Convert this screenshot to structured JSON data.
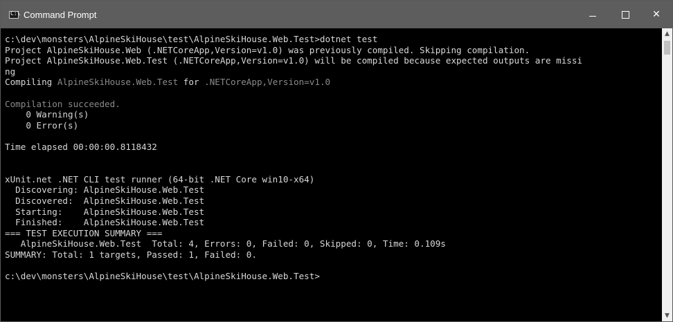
{
  "window": {
    "title": "Command Prompt",
    "controls": {
      "minimize": "—",
      "maximize": "",
      "close": "✕"
    },
    "app_icon": "command-prompt-icon",
    "icon_glyph": "C:\\"
  },
  "console": {
    "lines": [
      {
        "text": "c:\\dev\\monsters\\AlpineSkiHouse\\test\\AlpineSkiHouse.Web.Test>dotnet test"
      },
      {
        "text": "Project AlpineSkiHouse.Web (.NETCoreApp,Version=v1.0) was previously compiled. Skipping compilation."
      },
      {
        "text": "Project AlpineSkiHouse.Web.Test (.NETCoreApp,Version=v1.0) will be compiled because expected outputs are missi"
      },
      {
        "text": "ng"
      },
      {
        "parts": [
          {
            "text": "Compiling ",
            "style": "normal"
          },
          {
            "text": "AlpineSkiHouse.Web.Test",
            "style": "dim"
          },
          {
            "text": " for ",
            "style": "normal"
          },
          {
            "text": ".NETCoreApp,Version=v1.0",
            "style": "dim"
          }
        ]
      },
      {
        "text": ""
      },
      {
        "text": "Compilation succeeded.",
        "style": "dim"
      },
      {
        "text": "    0 Warning(s)"
      },
      {
        "text": "    0 Error(s)"
      },
      {
        "text": ""
      },
      {
        "text": "Time elapsed 00:00:00.8118432"
      },
      {
        "text": ""
      },
      {
        "text": ""
      },
      {
        "text": "xUnit.net .NET CLI test runner (64-bit .NET Core win10-x64)"
      },
      {
        "text": "  Discovering: AlpineSkiHouse.Web.Test"
      },
      {
        "text": "  Discovered:  AlpineSkiHouse.Web.Test"
      },
      {
        "text": "  Starting:    AlpineSkiHouse.Web.Test"
      },
      {
        "text": "  Finished:    AlpineSkiHouse.Web.Test"
      },
      {
        "text": "=== TEST EXECUTION SUMMARY ==="
      },
      {
        "text": "   AlpineSkiHouse.Web.Test  Total: 4, Errors: 0, Failed: 0, Skipped: 0, Time: 0.109s"
      },
      {
        "text": "SUMMARY: Total: 1 targets, Passed: 1, Failed: 0."
      },
      {
        "text": ""
      },
      {
        "text": "c:\\dev\\monsters\\AlpineSkiHouse\\test\\AlpineSkiHouse.Web.Test>"
      }
    ]
  },
  "scrollbar": {
    "up_icon": "▲",
    "down_icon": "▼"
  },
  "colors": {
    "titlebar": "#5d5d5d",
    "console_bg": "#000000",
    "text": "#d8d8d8",
    "dim_text": "#8a8a8a",
    "scrollbar_bg": "#f0f0f0"
  }
}
